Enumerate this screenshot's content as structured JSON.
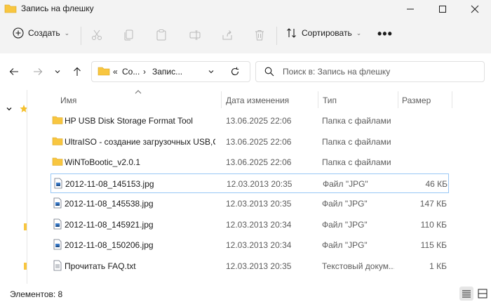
{
  "window": {
    "title": "Запись на флешку"
  },
  "toolbar": {
    "new_label": "Создать",
    "sort_label": "Сортировать",
    "more_label": "•••"
  },
  "address": {
    "seg1": "Co...",
    "seg2": "Запис..."
  },
  "search": {
    "placeholder": "Поиск в: Запись на флешку"
  },
  "columns": {
    "name": "Имя",
    "date": "Дата изменения",
    "type": "Тип",
    "size": "Размер"
  },
  "rows": [
    {
      "icon": "folder-icon",
      "name": "HP USB Disk Storage Format Tool",
      "date": "13.06.2025 22:06",
      "type": "Папка с файлами",
      "size": ""
    },
    {
      "icon": "folder-icon",
      "name": "UltraISO - создание загрузочных USB,C...",
      "date": "13.06.2025 22:06",
      "type": "Папка с файлами",
      "size": ""
    },
    {
      "icon": "folder-icon",
      "name": "WiNToBootic_v2.0.1",
      "date": "13.06.2025 22:06",
      "type": "Папка с файлами",
      "size": ""
    },
    {
      "icon": "image-file-icon",
      "name": "2012-11-08_145153.jpg",
      "date": "12.03.2013 20:35",
      "type": "Файл \"JPG\"",
      "size": "46 КБ"
    },
    {
      "icon": "image-file-icon",
      "name": "2012-11-08_145538.jpg",
      "date": "12.03.2013 20:35",
      "type": "Файл \"JPG\"",
      "size": "147 КБ"
    },
    {
      "icon": "image-file-icon",
      "name": "2012-11-08_145921.jpg",
      "date": "12.03.2013 20:34",
      "type": "Файл \"JPG\"",
      "size": "110 КБ"
    },
    {
      "icon": "image-file-icon",
      "name": "2012-11-08_150206.jpg",
      "date": "12.03.2013 20:34",
      "type": "Файл \"JPG\"",
      "size": "115 КБ"
    },
    {
      "icon": "text-file-icon",
      "name": "Прочитать FAQ.txt",
      "date": "12.03.2013 20:35",
      "type": "Текстовый докум...",
      "size": "1 КБ"
    }
  ],
  "status": {
    "count_label": "Элементов: 8"
  },
  "colors": {
    "folder": "#f8c640",
    "accent": "#0067c0",
    "selection_border": "#99c8f5"
  }
}
